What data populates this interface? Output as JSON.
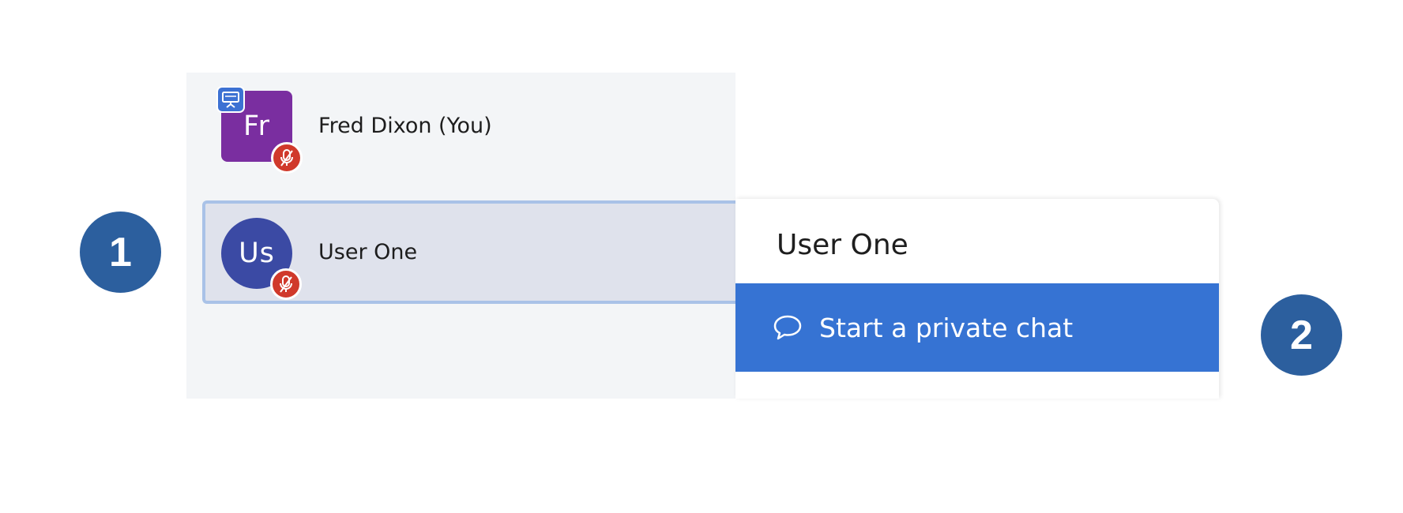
{
  "users": [
    {
      "name": "Fred Dixon (You)",
      "initials": "Fr",
      "avatar_shape": "square",
      "avatar_color": "#7a2ea0",
      "is_presenter": true,
      "muted": true,
      "icons": [
        "presentation-icon",
        "mic-muted-icon"
      ]
    },
    {
      "name": "User One",
      "initials": "Us",
      "avatar_shape": "round",
      "avatar_color": "#3b4aa4",
      "is_presenter": false,
      "muted": true,
      "selected": true,
      "icons": [
        "mic-muted-icon"
      ]
    }
  ],
  "dropdown": {
    "title": "User One",
    "items": [
      {
        "label": "Start a private chat",
        "icon": "chat-bubble-icon",
        "highlighted": true
      }
    ]
  },
  "callouts": [
    "1",
    "2"
  ],
  "colors": {
    "panel_bg": "#f3f5f7",
    "selected_row_bg": "#dfe2ec",
    "selected_row_border": "#a9c2e7",
    "menu_highlight": "#3673d3",
    "muted_badge": "#d0392b",
    "presenter_badge": "#3c71d3",
    "callout": "#2c5f9e"
  }
}
